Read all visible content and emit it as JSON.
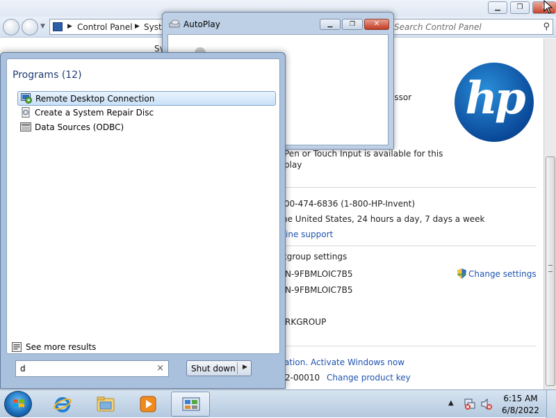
{
  "control_panel": {
    "breadcrumb": [
      "Control Panel",
      "Syste"
    ],
    "search_placeholder": "Search Control Panel",
    "behind_fragment": "Sy",
    "lines": {
      "processor": "essor",
      "pen_touch": "Pen or Touch Input is available for this",
      "display": "play",
      "phone": "00-474-6836 (1-800-HP-Invent)",
      "hours": "he United States, 24 hours a day, 7 days a week",
      "online_support": "ine support",
      "workgroup_settings": "tgroup settings",
      "computer_name": "N-9FBMLOIC7B5",
      "full_computer_name": "N-9FBMLOIC7B5",
      "workgroup": "RKGROUP",
      "activation": "ation. Activate Windows now",
      "product_id": "2-00010"
    },
    "change_settings": "Change settings",
    "change_product_key": "Change product key",
    "logo_text": "hp"
  },
  "autoplay": {
    "title": "AutoPlay"
  },
  "start_menu": {
    "programs_header": "Programs (12)",
    "programs": [
      {
        "label": "Remote Desktop Connection",
        "selected": true
      },
      {
        "label": "Create a System Repair Disc",
        "selected": false
      },
      {
        "label": "Data Sources (ODBC)",
        "selected": false
      }
    ],
    "see_more": "See more results",
    "search_value": "d",
    "search_clear": "×",
    "shutdown_label": "Shut down"
  },
  "taskbar": {
    "time": "6:15 AM",
    "date": "6/8/2022"
  },
  "colors": {
    "link": "#1e53b0",
    "hp_blue": "#0a4a9a",
    "taskbar": "#b4c9df"
  }
}
